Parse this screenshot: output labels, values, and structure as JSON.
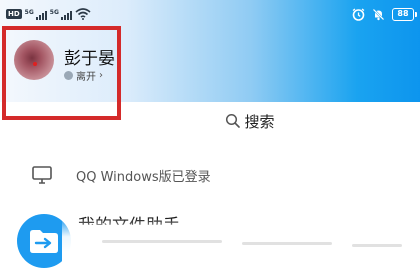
{
  "status_bar": {
    "hd_label": "HD",
    "signal_1_label": "5G",
    "signal_2_label": "5G",
    "battery_level": "88",
    "wifi_icon": "wifi-icon",
    "alarm_icon": "alarm-icon",
    "mute_icon": "bell-muted-icon"
  },
  "profile": {
    "nickname": "彭于晏",
    "status_text": "离开",
    "status_chevron": "›"
  },
  "search": {
    "label": "搜索",
    "icon": "search-icon"
  },
  "device_login": {
    "text": "QQ Windows版已登录",
    "icon": "monitor-icon"
  },
  "file_assistant": {
    "title": "我的文件助手",
    "icon": "file-transfer-icon"
  },
  "colors": {
    "header_blue": "#0d95ee",
    "highlight_red": "#d42a2a",
    "file_icon_blue": "#1e9bf0"
  }
}
